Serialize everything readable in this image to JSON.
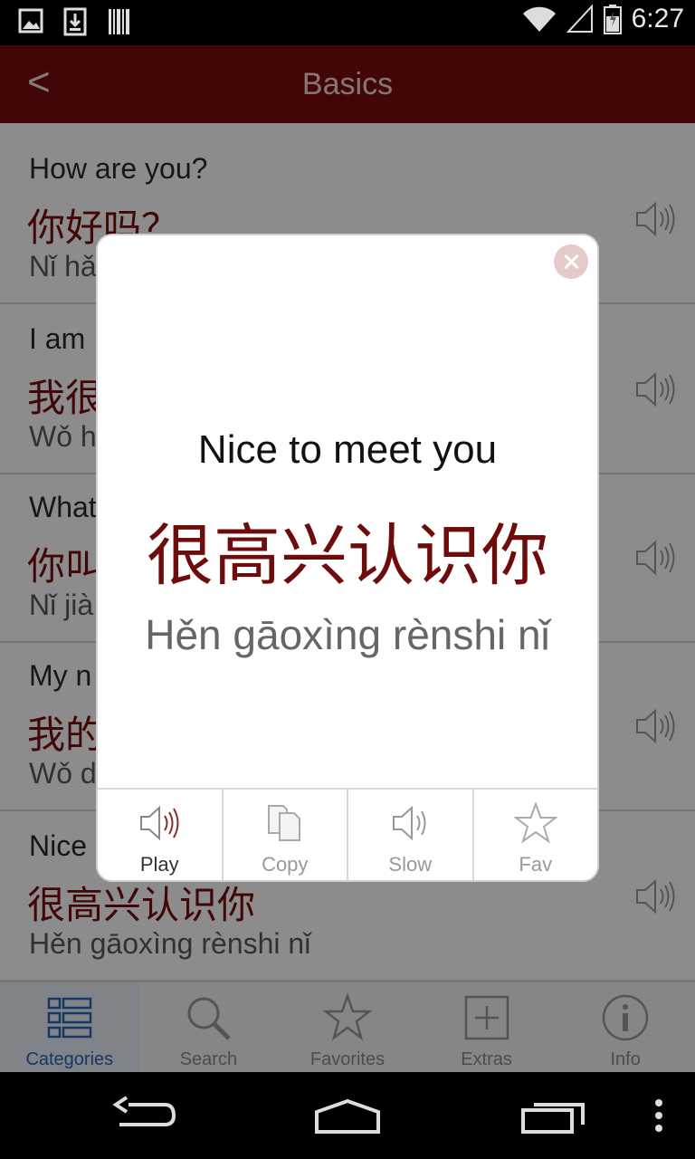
{
  "status": {
    "time": "6:27"
  },
  "appbar": {
    "back_label": "<",
    "title": "Basics"
  },
  "list": [
    {
      "en": "How are you?",
      "zh": "你好吗？",
      "py": "Nǐ hǎo ma?"
    },
    {
      "en": "I am",
      "zh": "我很",
      "py": "Wǒ h"
    },
    {
      "en": "What",
      "zh": "你叫",
      "py": "Nǐ jià"
    },
    {
      "en": "My n",
      "zh": "我的",
      "py": "Wǒ d"
    },
    {
      "en": "Nice",
      "zh": "很高兴认识你",
      "py": "Hěn gāoxìng rènshi nǐ"
    }
  ],
  "tabs": [
    {
      "label": "Categories",
      "icon": "categories-icon",
      "active": true
    },
    {
      "label": "Search",
      "icon": "search-icon"
    },
    {
      "label": "Favorites",
      "icon": "star-icon"
    },
    {
      "label": "Extras",
      "icon": "plus-box-icon"
    },
    {
      "label": "Info",
      "icon": "info-icon"
    }
  ],
  "dialog": {
    "en": "Nice to meet you",
    "zh": "很高兴认识你",
    "py": "Hěn gāoxìng rènshi nǐ",
    "actions": {
      "play": "Play",
      "copy": "Copy",
      "slow": "Slow",
      "fav": "Fav"
    }
  },
  "colors": {
    "appbar": "#7a0c0c",
    "chinese_text": "#7a0c0c",
    "active_tab": "#2a64b8"
  }
}
